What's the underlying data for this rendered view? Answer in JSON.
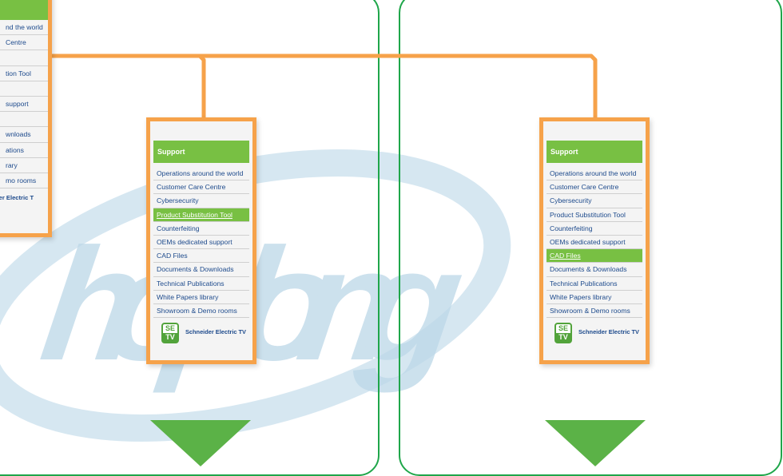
{
  "watermark": {
    "text": "hoplong"
  },
  "colors": {
    "panel_border": "#1fa64a",
    "frame": "#f6a24a",
    "menu_header": "#78c043",
    "link": "#1d4a8c",
    "arrow": "#5bb247"
  },
  "cropped_menu": {
    "items": [
      "nd the world",
      "Centre",
      "",
      "tion Tool",
      "",
      "support",
      "",
      "wnloads",
      "ations",
      "rary",
      "mo rooms"
    ],
    "footer_label": "neider Electric T"
  },
  "menu_left": {
    "header": "Support",
    "active_item": "Product Substitution Tool",
    "items": [
      "Operations around the world",
      "Customer Care Centre",
      "Cybersecurity",
      "Product Substitution Tool",
      "Counterfeiting",
      "OEMs dedicated support",
      "CAD Files",
      "Documents & Downloads",
      "Technical Publications",
      "White Papers library",
      "Showroom & Demo rooms"
    ],
    "footer": {
      "icon_top": "SE",
      "icon_bottom": "TV",
      "label": "Schneider Electric TV"
    }
  },
  "menu_right": {
    "header": "Support",
    "active_item": "CAD Files",
    "items": [
      "Operations around the world",
      "Customer Care Centre",
      "Cybersecurity",
      "Product Substitution Tool",
      "Counterfeiting",
      "OEMs dedicated support",
      "CAD Files",
      "Documents & Downloads",
      "Technical Publications",
      "White Papers library",
      "Showroom & Demo rooms"
    ],
    "footer": {
      "icon_top": "SE",
      "icon_bottom": "TV",
      "label": "Schneider Electric TV"
    }
  }
}
